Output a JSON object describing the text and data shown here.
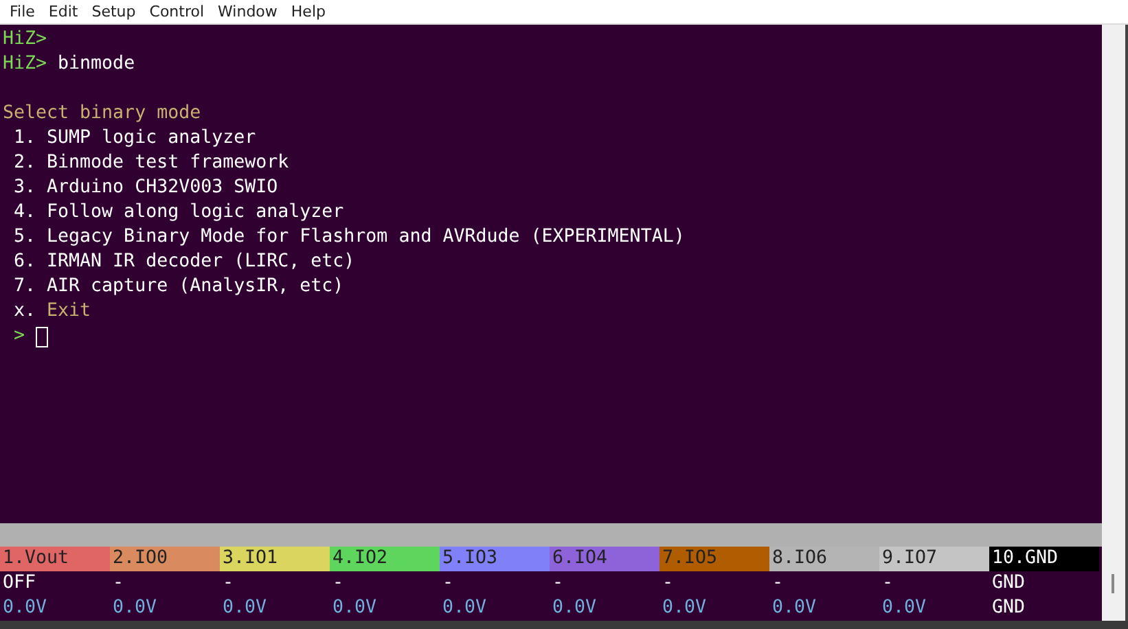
{
  "menu": [
    "File",
    "Edit",
    "Setup",
    "Control",
    "Window",
    "Help"
  ],
  "terminal": {
    "lines": [
      {
        "segments": [
          {
            "kind": "prompt",
            "text": "HiZ>"
          }
        ]
      },
      {
        "segments": [
          {
            "kind": "prompt",
            "text": "HiZ>"
          },
          {
            "kind": "input",
            "text": "binmode"
          }
        ]
      },
      {
        "segments": [
          {
            "kind": "heading",
            "text": "Select binary mode"
          }
        ]
      },
      {
        "segments": [
          {
            "kind": "text",
            "text": " 1. SUMP logic analyzer"
          }
        ]
      },
      {
        "segments": [
          {
            "kind": "text",
            "text": " 2. Binmode test framework"
          }
        ]
      },
      {
        "segments": [
          {
            "kind": "text",
            "text": " 3. Arduino CH32V003 SWIO"
          }
        ]
      },
      {
        "segments": [
          {
            "kind": "text",
            "text": " 4. Follow along logic analyzer"
          }
        ]
      },
      {
        "segments": [
          {
            "kind": "text",
            "text": " 5. Legacy Binary Mode for Flashrom and AVRdude (EXPERIMENTAL)"
          }
        ]
      },
      {
        "segments": [
          {
            "kind": "text",
            "text": " 6. IRMAN IR decoder (LIRC, etc)"
          }
        ]
      },
      {
        "segments": [
          {
            "kind": "text",
            "text": " 7. AIR capture (AnalysIR, etc)"
          }
        ]
      },
      {
        "segments": [
          {
            "kind": "text",
            "text": " x."
          },
          {
            "kind": "heading",
            "text": "Exit"
          }
        ]
      },
      {
        "segments": [
          {
            "kind": "prompt",
            "text": " >"
          }
        ],
        "cursor": true
      }
    ]
  },
  "pins": [
    {
      "label": "1.Vout",
      "color": "#e06666",
      "state": "OFF",
      "voltage": "0.0V"
    },
    {
      "label": "2.IO0",
      "color": "#d98a5e",
      "state": "-",
      "voltage": "0.0V"
    },
    {
      "label": "3.IO1",
      "color": "#d9d55e",
      "state": "-",
      "voltage": "0.0V"
    },
    {
      "label": "4.IO2",
      "color": "#5ed65e",
      "state": "-",
      "voltage": "0.0V"
    },
    {
      "label": "5.IO3",
      "color": "#8080f8",
      "state": "-",
      "voltage": "0.0V"
    },
    {
      "label": "6.IO4",
      "color": "#8e62d9",
      "state": "-",
      "voltage": "0.0V"
    },
    {
      "label": "7.IO5",
      "color": "#b05c00",
      "state": "-",
      "voltage": "0.0V"
    },
    {
      "label": "8.IO6",
      "color": "#b4b4b4",
      "state": "-",
      "voltage": "0.0V"
    },
    {
      "label": "9.IO7",
      "color": "#c4c4c4",
      "state": "-",
      "voltage": "0.0V"
    },
    {
      "label": "10.GND",
      "color": "#000000",
      "state": "GND",
      "voltage": "GND"
    }
  ]
}
